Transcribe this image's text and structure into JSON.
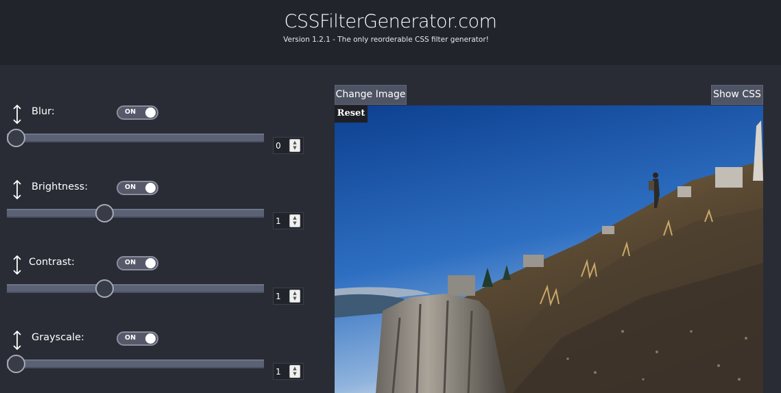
{
  "header": {
    "title": "CSSFilterGenerator.com",
    "version": "Version 1.2.1 - The only reorderable CSS filter generator!"
  },
  "filters": [
    {
      "label": "Blur",
      "toggle": "ON",
      "value": "0",
      "level": 0.0
    },
    {
      "label": "Brightness",
      "toggle": "ON",
      "value": "1",
      "level": 0.345
    },
    {
      "label": "Contrast",
      "toggle": "ON",
      "value": "1",
      "level": 0.345
    },
    {
      "label": "Grayscale",
      "toggle": "ON",
      "value": "1",
      "level": 0.0
    }
  ],
  "preview": {
    "change_image_label": "Change Image",
    "show_css_label": "Show CSS",
    "reset_label": "Reset"
  },
  "icons": {
    "reorder": "up-down-arrow-icon",
    "spinner_up": "caret-up-icon",
    "spinner_down": "caret-down-icon"
  },
  "colors": {
    "background": "#292c35",
    "header": "#21242b",
    "button": "#4f5464",
    "track": "#5c6275"
  }
}
